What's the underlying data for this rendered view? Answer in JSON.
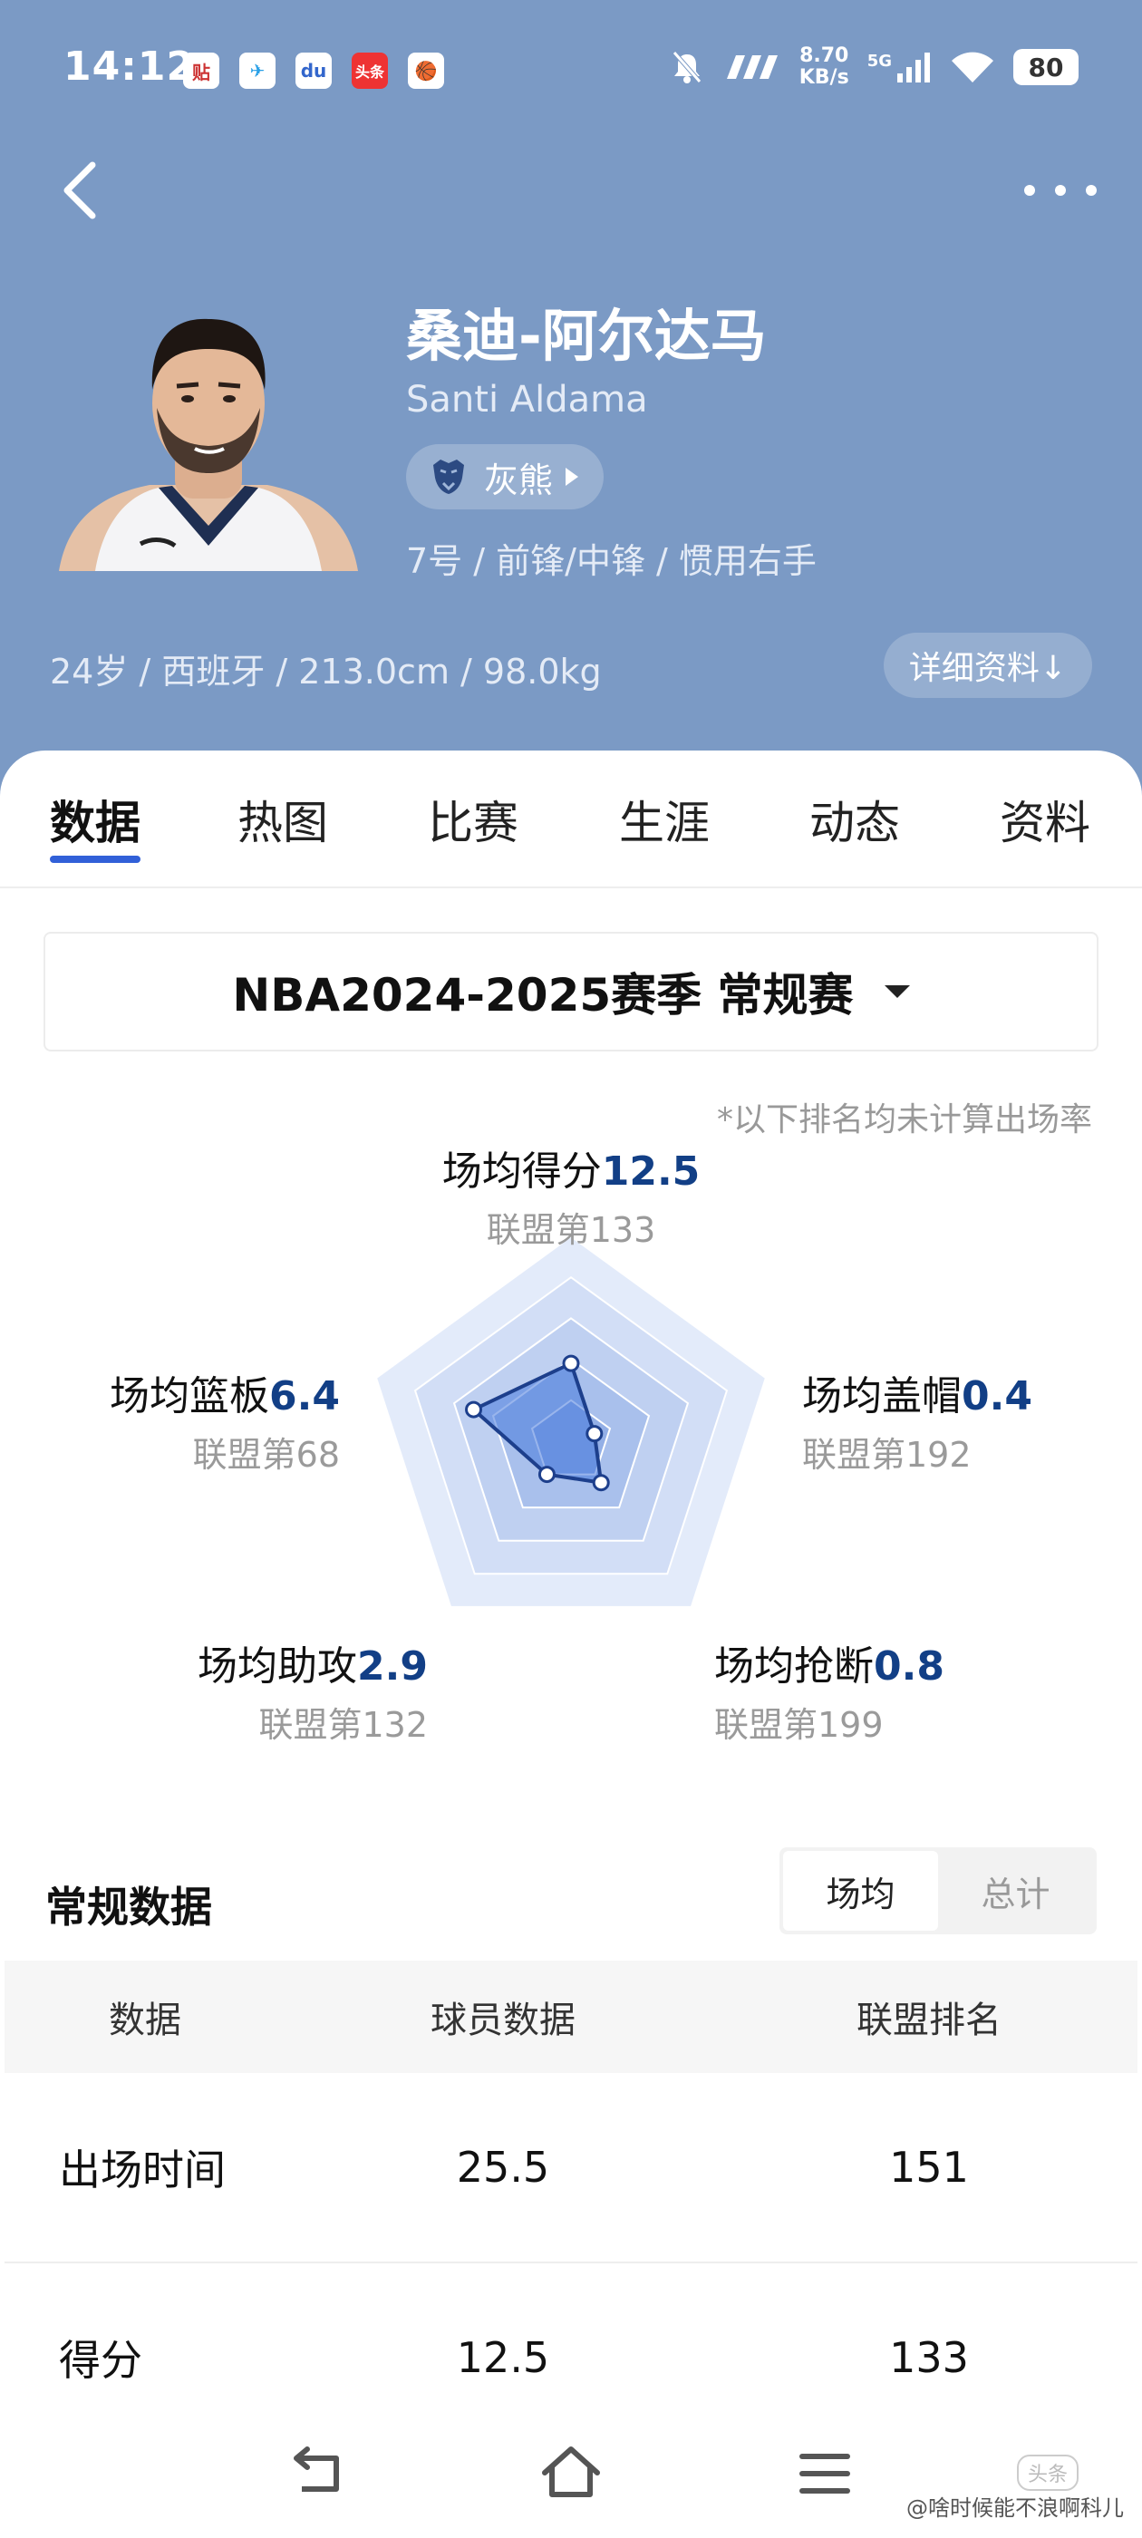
{
  "status_bar": {
    "time": "14:12",
    "apps": [
      "贴",
      "✈",
      "du",
      "头条",
      "🏀"
    ],
    "net_speed_value": "8.70",
    "net_speed_unit": "KB/s",
    "network": "5G",
    "battery": "80"
  },
  "player": {
    "name": "桑迪-阿尔达马",
    "name_en": "Santi Aldama",
    "team": "灰熊",
    "meta": "7号 / 前锋/中锋 / 惯用右手",
    "bio": "24岁 / 西班牙 / 213.0cm / 98.0kg",
    "detail_label": "详细资料↓"
  },
  "tabs": [
    {
      "label": "数据",
      "active": true
    },
    {
      "label": "热图"
    },
    {
      "label": "比赛"
    },
    {
      "label": "生涯"
    },
    {
      "label": "动态"
    },
    {
      "label": "资料"
    }
  ],
  "season": "NBA2024-2025赛季 常规赛",
  "rank_note": "*以下排名均未计算出场率",
  "radar": {
    "points": {
      "label": "场均得分",
      "value": "12.5",
      "rank": "联盟第133",
      "level": 0.38
    },
    "blocks": {
      "label": "场均盖帽",
      "value": "0.4",
      "rank": "联盟第192",
      "level": 0.12
    },
    "steals": {
      "label": "场均抢断",
      "value": "0.8",
      "rank": "联盟第199",
      "level": 0.25
    },
    "assists": {
      "label": "场均助攻",
      "value": "2.9",
      "rank": "联盟第132",
      "level": 0.2
    },
    "rebounds": {
      "label": "场均篮板",
      "value": "6.4",
      "rank": "联盟第68",
      "level": 0.5
    }
  },
  "regular_stats": {
    "title": "常规数据",
    "toggle": [
      "场均",
      "总计"
    ],
    "headers": [
      "数据",
      "球员数据",
      "联盟排名"
    ],
    "rows": [
      {
        "name": "出场时间",
        "value": "25.5",
        "rank": "151"
      },
      {
        "name": "得分",
        "value": "12.5",
        "rank": "133"
      }
    ]
  },
  "watermark": "@啥时候能不浪啊科儿",
  "watermark_logo": "头条"
}
